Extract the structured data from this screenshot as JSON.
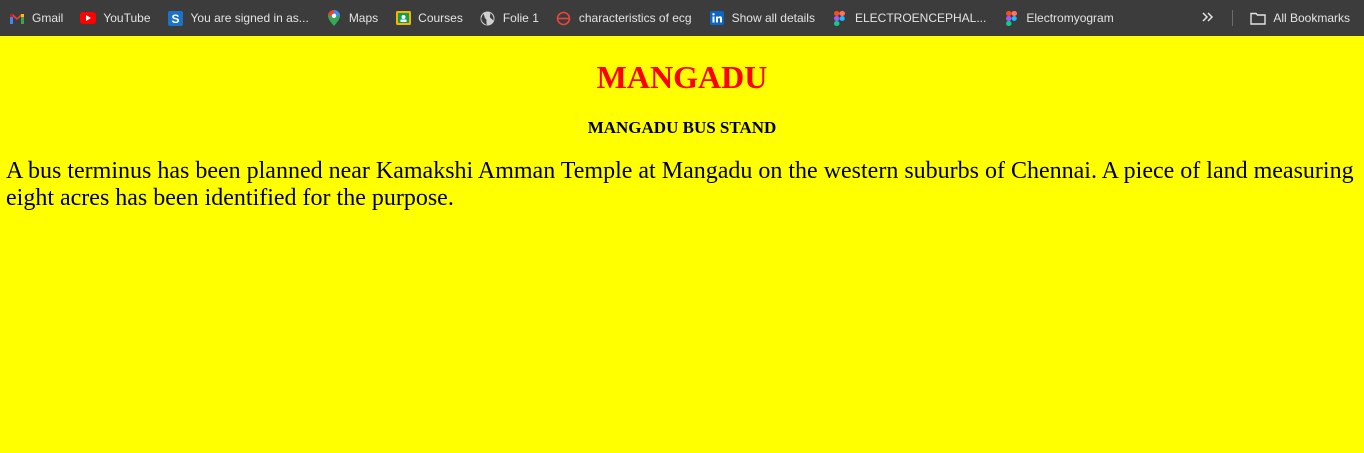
{
  "bookmarks": [
    {
      "label": "Gmail",
      "icon": "gmail-icon"
    },
    {
      "label": "YouTube",
      "icon": "youtube-icon"
    },
    {
      "label": "You are signed in as...",
      "icon": "s-logo-icon"
    },
    {
      "label": "Maps",
      "icon": "maps-pin-icon"
    },
    {
      "label": "Courses",
      "icon": "courses-icon"
    },
    {
      "label": "Folie 1",
      "icon": "globe-icon"
    },
    {
      "label": "characteristics of ecg",
      "icon": "no-entry-icon"
    },
    {
      "label": "Show all details",
      "icon": "linkedin-icon"
    },
    {
      "label": "ELECTROENCEPHAL...",
      "icon": "figma-icon"
    },
    {
      "label": "Electromyogram",
      "icon": "figma-icon"
    }
  ],
  "overflow_icon": "double-chevron-icon",
  "all_bookmarks": {
    "label": "All Bookmarks",
    "icon": "folder-icon"
  },
  "page": {
    "title": "MANGADU",
    "subtitle": "MANGADU BUS STAND",
    "paragraph": "A bus terminus has been planned near Kamakshi Amman Temple at Mangadu on the western suburbs of Chennai. A piece of land measuring eight acres has been identified for the purpose."
  },
  "colors": {
    "page_background": "#ffff00",
    "title": "#ff0000",
    "bookmarks_bar": "#3c3c3c"
  }
}
